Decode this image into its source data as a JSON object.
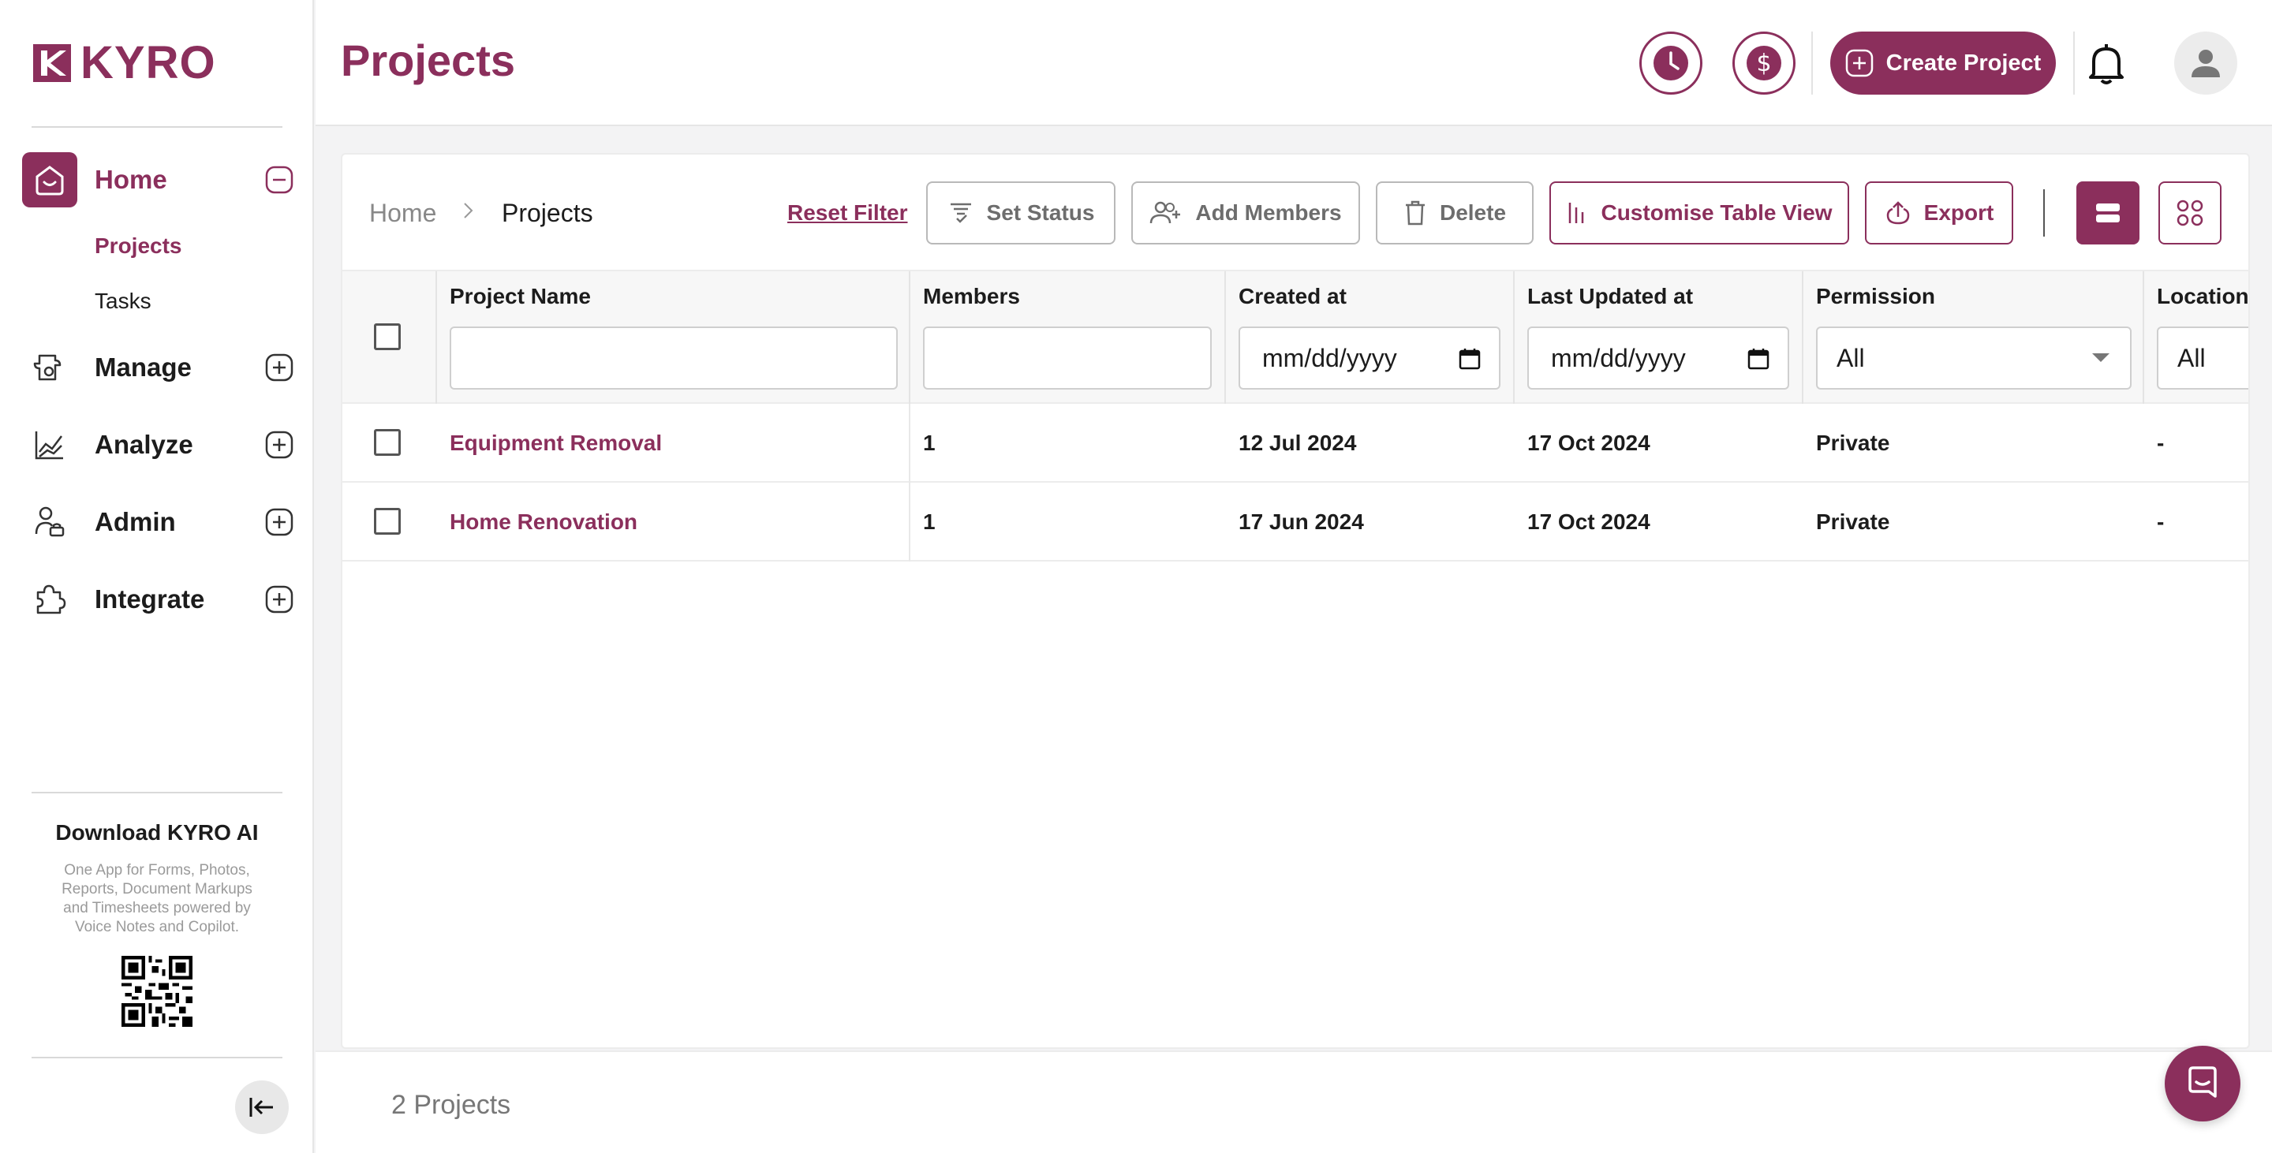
{
  "app": {
    "brand": "KYRO",
    "accent_color": "#8b2f5c"
  },
  "sidebar": {
    "nav": [
      {
        "label": "Home",
        "icon": "home-icon",
        "state": "expanded"
      },
      {
        "label": "Manage",
        "icon": "manage-icon",
        "state": "collapsed"
      },
      {
        "label": "Analyze",
        "icon": "analytics-icon",
        "state": "collapsed"
      },
      {
        "label": "Admin",
        "icon": "admin-icon",
        "state": "collapsed"
      },
      {
        "label": "Integrate",
        "icon": "puzzle-icon",
        "state": "collapsed"
      }
    ],
    "home_sub": [
      {
        "label": "Projects",
        "active": true
      },
      {
        "label": "Tasks",
        "active": false
      }
    ],
    "download_title": "Download KYRO AI",
    "download_desc": "One App for Forms, Photos, Reports, Document Markups and Timesheets powered by Voice Notes and Copilot."
  },
  "header": {
    "title": "Projects",
    "create_label": "Create Project"
  },
  "toolbar": {
    "breadcrumb_home": "Home",
    "breadcrumb_current": "Projects",
    "reset_filter": "Reset Filter",
    "set_status": "Set Status",
    "add_members": "Add Members",
    "delete": "Delete",
    "customise": "Customise Table View",
    "export": "Export"
  },
  "table": {
    "columns": [
      "Project Name",
      "Members",
      "Created at",
      "Last Updated at",
      "Permission",
      "Location"
    ],
    "filters": {
      "created_at_placeholder": "mm/dd/yyyy",
      "updated_at_placeholder": "mm/dd/yyyy",
      "permission_value": "All",
      "location_value": "All"
    },
    "rows": [
      {
        "name": "Equipment Removal",
        "members": "1",
        "created": "12 Jul 2024",
        "updated": "17 Oct 2024",
        "permission": "Private",
        "location": "-"
      },
      {
        "name": "Home Renovation",
        "members": "1",
        "created": "17 Jun 2024",
        "updated": "17 Oct 2024",
        "permission": "Private",
        "location": "-"
      }
    ]
  },
  "footer": {
    "count": "2 Projects"
  }
}
